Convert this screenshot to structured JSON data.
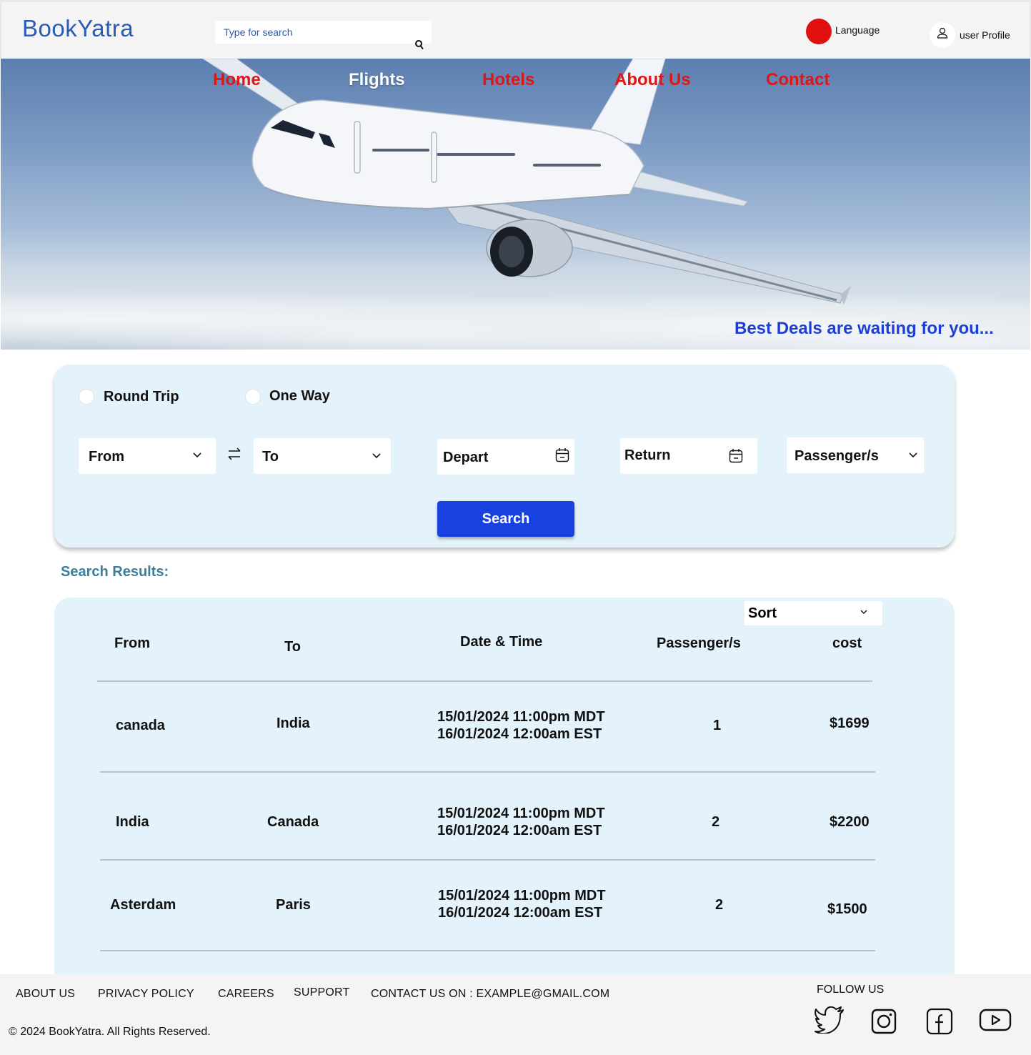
{
  "header": {
    "logo": "BookYatra",
    "search_placeholder": "Type for search",
    "language_label": "Language",
    "profile_label": "user Profile"
  },
  "nav": {
    "items": [
      "Home",
      "Flights",
      "Hotels",
      "About Us",
      "Contact"
    ],
    "active": "Flights"
  },
  "hero": {
    "tagline": "Best Deals are waiting for you..."
  },
  "search_form": {
    "trip_types": [
      "Round Trip",
      "One Way"
    ],
    "from_label": "From",
    "to_label": "To",
    "depart_label": "Depart",
    "return_label": "Return",
    "passengers_label": "Passenger/s",
    "search_button": "Search"
  },
  "results": {
    "title": "Search Results:",
    "sort_label": "Sort",
    "columns": [
      "From",
      "To",
      "Date & Time",
      "Passenger/s",
      "cost"
    ],
    "rows": [
      {
        "from": "canada",
        "to": "India",
        "depart": "15/01/2024 11:00pm MDT",
        "arrive": "16/01/2024 12:00am EST",
        "passengers": "1",
        "cost": "$1699"
      },
      {
        "from": "India",
        "to": "Canada",
        "depart": "15/01/2024 11:00pm MDT",
        "arrive": "16/01/2024 12:00am EST",
        "passengers": "2",
        "cost": "$2200"
      },
      {
        "from": "Asterdam",
        "to": "Paris",
        "depart": "15/01/2024 11:00pm MDT",
        "arrive": "16/01/2024 12:00am EST",
        "passengers": "2",
        "cost": "$1500"
      }
    ]
  },
  "footer": {
    "links": [
      "ABOUT US",
      "PRIVACY POLICY",
      "CAREERS",
      "SUPPORT",
      "CONTACT US ON : EXAMPLE@GMAIL.COM"
    ],
    "copyright": "© 2024  BookYatra. All Rights Reserved.",
    "follow_label": "FOLLOW US",
    "social_icons": [
      "twitter-icon",
      "instagram-icon",
      "facebook-icon",
      "youtube-icon"
    ]
  },
  "colors": {
    "brand_blue": "#2a5bb5",
    "nav_red": "#e01515",
    "button_blue": "#1841e0",
    "panel_bg": "#e4f3fb",
    "results_title": "#3a7f97"
  }
}
